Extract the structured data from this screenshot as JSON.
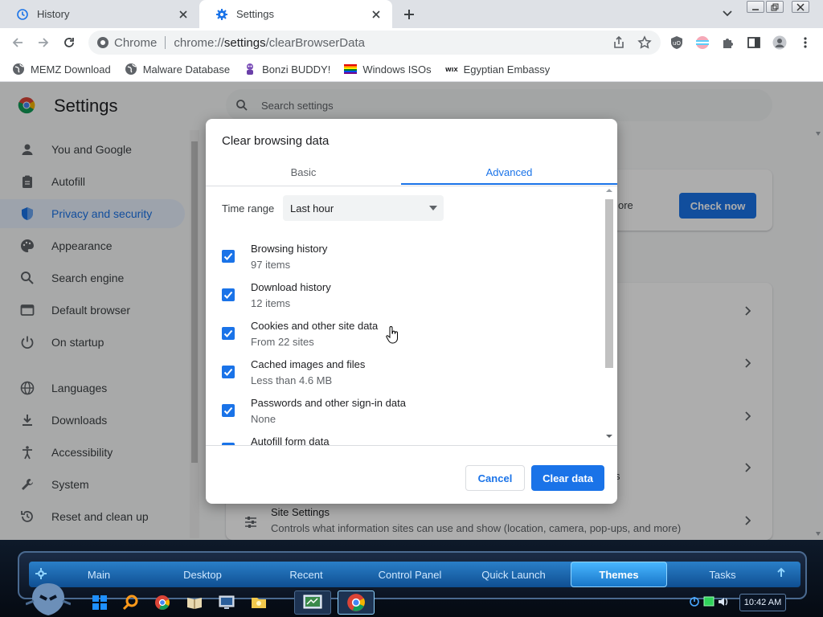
{
  "browser": {
    "tabs": [
      {
        "title": "History",
        "icon": "history-icon",
        "active": false
      },
      {
        "title": "Settings",
        "icon": "gear-icon",
        "active": true
      }
    ],
    "omnibox": {
      "chip": "Chrome",
      "url_prefix": "chrome://",
      "url_host": "settings",
      "url_path": "/clearBrowserData"
    },
    "bookmarks": [
      {
        "label": "MEMZ Download",
        "icon": "globe-icon"
      },
      {
        "label": "Malware Database",
        "icon": "globe-icon"
      },
      {
        "label": "Bonzi BUDDY!",
        "icon": "bonzi-icon"
      },
      {
        "label": "Windows ISOs",
        "icon": "rainbow-flag-icon"
      },
      {
        "label": "Egyptian Embassy",
        "icon": "wix-icon"
      }
    ]
  },
  "settings": {
    "title": "Settings",
    "search_placeholder": "Search settings",
    "sidebar": [
      {
        "label": "You and Google",
        "icon": "person-icon"
      },
      {
        "label": "Autofill",
        "icon": "clipboard-icon"
      },
      {
        "label": "Privacy and security",
        "icon": "shield-icon",
        "active": true
      },
      {
        "label": "Appearance",
        "icon": "palette-icon"
      },
      {
        "label": "Search engine",
        "icon": "search-icon"
      },
      {
        "label": "Default browser",
        "icon": "browser-icon"
      },
      {
        "label": "On startup",
        "icon": "power-icon"
      },
      {
        "label": "Languages",
        "icon": "globe-icon"
      },
      {
        "label": "Downloads",
        "icon": "download-icon"
      },
      {
        "label": "Accessibility",
        "icon": "accessibility-icon"
      },
      {
        "label": "System",
        "icon": "wrench-icon"
      },
      {
        "label": "Reset and clean up",
        "icon": "restore-icon"
      }
    ],
    "safety_check": {
      "text_fragment": "ore",
      "button": "Check now"
    },
    "fragment_s": "s",
    "site_settings": {
      "title": "Site Settings",
      "description": "Controls what information sites can use and show (location, camera, pop-ups, and more)"
    }
  },
  "dialog": {
    "title": "Clear browsing data",
    "tabs": [
      "Basic",
      "Advanced"
    ],
    "selected_tab": "Advanced",
    "time_range": {
      "label": "Time range",
      "value": "Last hour"
    },
    "options": [
      {
        "title": "Browsing history",
        "subtitle": "97 items",
        "checked": true
      },
      {
        "title": "Download history",
        "subtitle": "12 items",
        "checked": true
      },
      {
        "title": "Cookies and other site data",
        "subtitle": "From 22 sites",
        "checked": true
      },
      {
        "title": "Cached images and files",
        "subtitle": "Less than 4.6 MB",
        "checked": true
      },
      {
        "title": "Passwords and other sign-in data",
        "subtitle": "None",
        "checked": true
      },
      {
        "title": "Autofill form data",
        "subtitle": "",
        "checked": true
      }
    ],
    "cancel_label": "Cancel",
    "confirm_label": "Clear data"
  },
  "taskbar": {
    "menu": [
      "Main",
      "Desktop",
      "Recent",
      "Control Panel",
      "Quick Launch",
      "Themes",
      "Tasks"
    ],
    "active_menu": "Themes",
    "clock": "10:42 AM"
  },
  "colors": {
    "accent": "#1a73e8"
  }
}
